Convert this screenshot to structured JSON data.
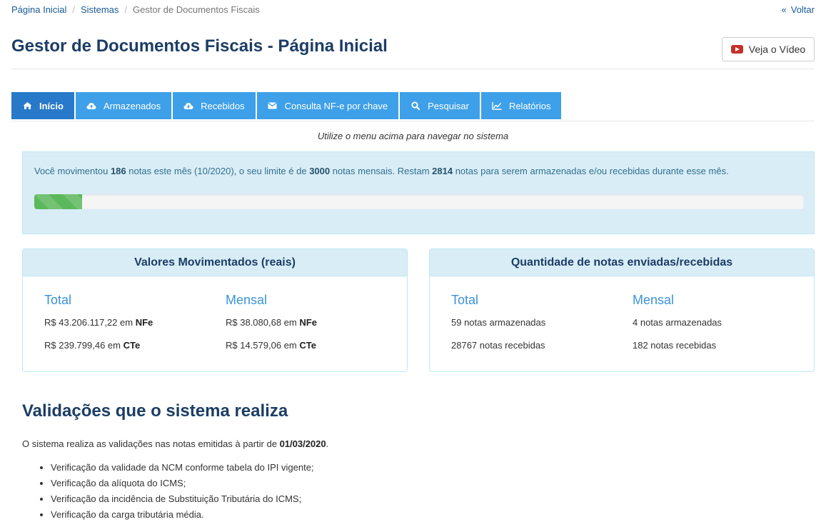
{
  "breadcrumb": {
    "home": "Página Inicial",
    "systems": "Sistemas",
    "current": "Gestor de Documentos Fiscais"
  },
  "back": {
    "label": "Voltar"
  },
  "header": {
    "title": "Gestor de Documentos Fiscais - Página Inicial",
    "video_button": "Veja o Vídeo"
  },
  "tabs": [
    {
      "label": "Início",
      "icon": "home-icon",
      "active": true
    },
    {
      "label": "Armazenados",
      "icon": "cloud-upload-icon"
    },
    {
      "label": "Recebidos",
      "icon": "cloud-download-icon"
    },
    {
      "label": "Consulta NF-e por chave",
      "icon": "envelope-icon"
    },
    {
      "label": "Pesquisar",
      "icon": "search-icon"
    },
    {
      "label": "Relatórios",
      "icon": "line-chart-icon"
    }
  ],
  "hint": "Utilize o menu acima para navegar no sistema",
  "usage": {
    "t1": "Você movimentou ",
    "moved": "186",
    "t2": " notas este mês (10/2020), o seu limite é de ",
    "limit": "3000",
    "t3": " notas mensais. Restam ",
    "remaining": "2814",
    "t4": " notas para serem armazenadas e/ou recebidas durante esse mês.",
    "progress_fraction": 0.062
  },
  "values_panel": {
    "title": "Valores Movimentados (reais)",
    "total_header": "Total",
    "monthly_header": "Mensal",
    "total_nfe_amount": "R$ 43.206.117,22 em ",
    "total_cte_amount": "R$ 239.799,46 em ",
    "monthly_nfe_amount": "R$ 38.080,68 em ",
    "monthly_cte_amount": "R$ 14.579,06 em ",
    "nfe": "NFe",
    "cte": "CTe"
  },
  "quantity_panel": {
    "title": "Quantidade de notas enviadas/recebidas",
    "total_header": "Total",
    "monthly_header": "Mensal",
    "total_stored": "59 notas armazenadas",
    "total_received": "28767 notas recebidas",
    "monthly_stored": "4 notas armazenadas",
    "monthly_received": "182 notas recebidas"
  },
  "validations": {
    "title": "Validações que o sistema realiza",
    "intro": "O sistema realiza as validações nas notas emitidas à partir de ",
    "date": "01/03/2020",
    "intro_end": ".",
    "items": [
      "Verificação da validade da NCM conforme tabela do IPI vigente;",
      "Verificação da alíquota do ICMS;",
      "Verificação da incidência de Substituição Tributária do ICMS;",
      "Verificação da carga tributária média."
    ]
  },
  "colors": {
    "tab": "#3ea0e8",
    "tab_active": "#2879c9",
    "title": "#1c3d66",
    "alert_bg": "#d9edf7",
    "progress": "#5cb85c"
  }
}
